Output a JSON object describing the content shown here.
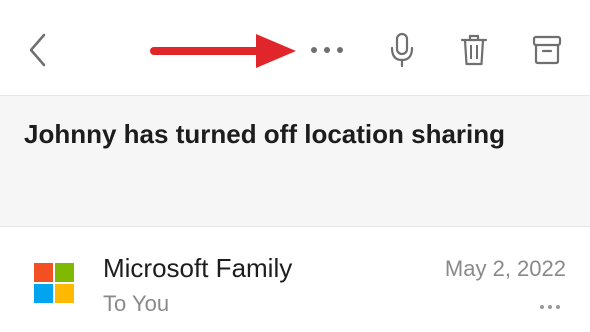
{
  "toolbar": {
    "icons": {
      "back": "chevron-left-icon",
      "more": "more-horizontal-icon",
      "mic": "microphone-icon",
      "trash": "trash-icon",
      "archive": "archive-icon"
    },
    "icon_color": "#6f6f6f"
  },
  "annotation": {
    "arrow_color": "#e0262b"
  },
  "email": {
    "subject": "Johnny has turned off location sharing",
    "sender": "Microsoft Family",
    "recipient": "To You",
    "date": "May 2, 2022",
    "logo_colors": [
      "#f25022",
      "#7fba00",
      "#00a4ef",
      "#ffb900"
    ]
  }
}
